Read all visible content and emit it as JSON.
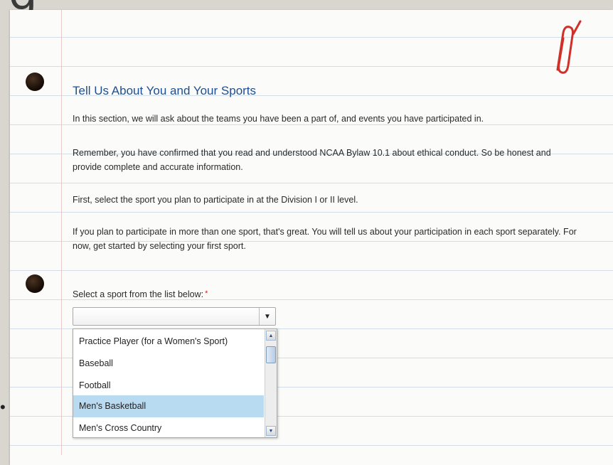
{
  "page": {
    "heading": "Tell Us About You and Your Sports",
    "paragraphs": [
      "In this section, we will ask about the teams you have been a part of, and events you have participated in.",
      "Remember, you have confirmed that you read and understood NCAA Bylaw 10.1 about ethical conduct. So be honest and provide complete and accurate information.",
      "First, select the sport you plan to participate in at the Division I or II level.",
      "If you plan to participate in more than one sport, that's great. You will tell us about your participation in each sport separately. For now, get started by selecting your first sport."
    ],
    "select_label": "Select a sport from the list below:",
    "required_marker": "*",
    "accent_color": "#1f4f90"
  },
  "sport_select": {
    "value": "",
    "arrow_glyph": "▼",
    "options": [
      "Practice Player (for a Women's Sport)",
      "Baseball",
      "Football",
      "Men's Basketball",
      "Men's Cross Country"
    ],
    "highlighted_option": "Men's Basketball",
    "scroll_up_glyph": "▲",
    "scroll_down_glyph": "▼"
  },
  "decor": {
    "background_glyph": "g",
    "edge_glyph": "•"
  }
}
